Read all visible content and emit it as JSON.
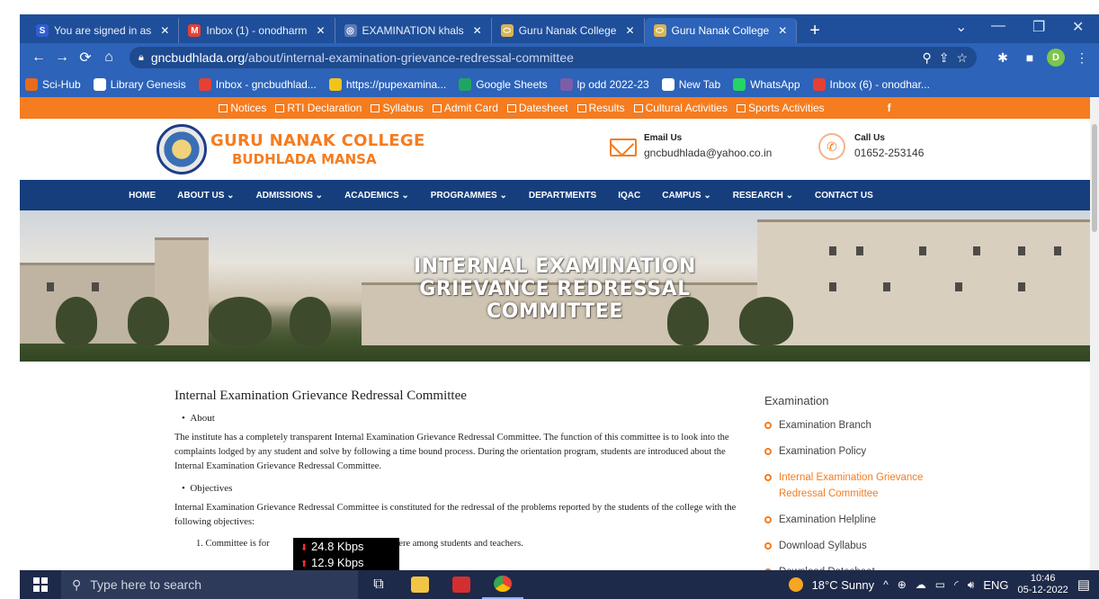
{
  "browser": {
    "tabs": [
      {
        "label": "You are signed in as",
        "icon": "sci-hub-icon",
        "color": "#2f5fd0",
        "glyph": "S"
      },
      {
        "label": "Inbox (1) - onodharm",
        "icon": "gmail-icon",
        "color": "#e44134",
        "glyph": "M"
      },
      {
        "label": "EXAMINATION khals",
        "icon": "chrome-circle-icon",
        "color": "#5b7bb7",
        "glyph": "◎"
      },
      {
        "label": "Guru Nanak College",
        "icon": "college-favicon",
        "color": "#d9b455",
        "glyph": "⬭"
      },
      {
        "label": "Guru Nanak College",
        "icon": "college-favicon",
        "color": "#d9b455",
        "glyph": "⬭",
        "active": true
      }
    ],
    "new_tab": "+",
    "url_host": "gncbudhlada.org",
    "url_path": "/about/internal-examination-grievance-redressal-committee",
    "profile_initial": "D",
    "bookmarks": [
      {
        "label": "Sci-Hub",
        "color": "#e86b1a"
      },
      {
        "label": "Library Genesis",
        "color": "#ffffff"
      },
      {
        "label": "Inbox - gncbudhlad...",
        "color": "#e44134"
      },
      {
        "label": "https://pupexamina...",
        "color": "#f0c419"
      },
      {
        "label": "Google Sheets",
        "color": "#1fa463"
      },
      {
        "label": "lp odd 2022-23",
        "color": "#7b5ea7"
      },
      {
        "label": "New Tab",
        "color": "#ffffff"
      },
      {
        "label": "WhatsApp",
        "color": "#25d366"
      },
      {
        "label": "Inbox (6) - onodhar...",
        "color": "#e44134"
      }
    ]
  },
  "site": {
    "topbar": [
      "Notices",
      "RTI Declaration",
      "Syllabus",
      "Admit Card",
      "Datesheet",
      "Results",
      "Cultural Activities",
      "Sports Activities"
    ],
    "facebook": "f",
    "college_name": "GURU NANAK COLLEGE",
    "college_place": "BUDHLADA MANSA",
    "email_title": "Email Us",
    "email": "gncbudhlada@yahoo.co.in",
    "call_title": "Call Us",
    "phone": "01652-253146",
    "nav": [
      "HOME",
      "ABOUT US ⌄",
      "ADMISSIONS ⌄",
      "ACADEMICS ⌄",
      "PROGRAMMES ⌄",
      "DEPARTMENTS",
      "IQAC",
      "CAMPUS ⌄",
      "RESEARCH ⌄",
      "CONTACT US"
    ],
    "hero_title_lines": [
      "INTERNAL EXAMINATION",
      "GRIEVANCE REDRESSAL",
      "COMMITTEE"
    ]
  },
  "content": {
    "heading": "Internal Examination Grievance Redressal Committee",
    "about_label": "About",
    "about_text": "The institute has a completely transparent Internal Examination Grievance Redressal Committee. The function of this committee is to look into the complaints lodged by any student and solve by following a time bound process. During the orientation program, students are introduced about the Internal Examination Grievance Redressal Committee.",
    "objectives_label": "Objectives",
    "objectives_text": "Internal Examination Grievance Redressal Committee is constituted for the redressal of the problems reported by the students of the college with the following objectives:",
    "item1": "1. Committee is for",
    "item1_tail": "orking atmosphere among students and teachers."
  },
  "sidebar": {
    "title": "Examination",
    "links": [
      {
        "label": "Examination Branch"
      },
      {
        "label": "Examination Policy"
      },
      {
        "label": "Internal Examination Grievance Redressal Committee",
        "active": true
      },
      {
        "label": "Examination Helpline"
      },
      {
        "label": "Download Syllabus"
      },
      {
        "label": "Download Datesheet"
      }
    ]
  },
  "netspeed": {
    "down": "24.8 Kbps",
    "up": "12.9 Kbps"
  },
  "taskbar": {
    "search_placeholder": "Type here to search",
    "weather": "18°C  Sunny",
    "lang": "ENG",
    "time": "10:46",
    "date": "05-12-2022"
  }
}
